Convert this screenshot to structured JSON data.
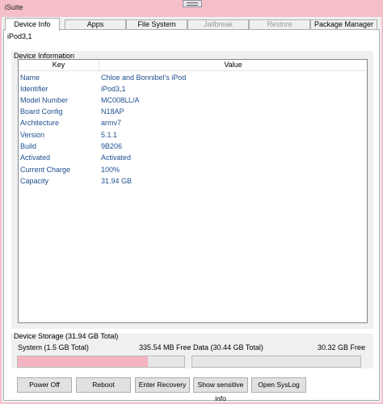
{
  "window": {
    "title": "iSuite"
  },
  "tabs": [
    {
      "label": "Device Info",
      "state": "active"
    },
    {
      "label": "Apps",
      "state": "normal"
    },
    {
      "label": "File System",
      "state": "normal"
    },
    {
      "label": "Jailbreak",
      "state": "disabled"
    },
    {
      "label": "Restore",
      "state": "disabled"
    },
    {
      "label": "Package Manager",
      "state": "normal"
    }
  ],
  "device_name": "iPod3,1",
  "device_information": {
    "legend": "Device Information",
    "columns": {
      "key": "Key",
      "value": "Value"
    },
    "rows": [
      {
        "key": "Name",
        "value": "Chloe and Bonnibel's iPod"
      },
      {
        "key": "Identifier",
        "value": "iPod3,1"
      },
      {
        "key": "Model Number",
        "value": "MC008LL/A"
      },
      {
        "key": "Board Config",
        "value": "N18AP"
      },
      {
        "key": "Architecture",
        "value": "armv7"
      },
      {
        "key": "Version",
        "value": "5.1.1"
      },
      {
        "key": "Build",
        "value": "9B206"
      },
      {
        "key": "Activated",
        "value": "Activated"
      },
      {
        "key": "Current Charge",
        "value": "100%"
      },
      {
        "key": "Capacity",
        "value": "31.94 GB"
      }
    ]
  },
  "storage": {
    "legend": "Device Storage (31.94 GB Total)",
    "system": {
      "label": "System (1.5 GB Total)",
      "free": "335.54 MB Free",
      "used_fraction": 0.78
    },
    "data": {
      "label": "Data (30.44 GB Total)",
      "free": "30.32 GB Free",
      "used_fraction": 0.0
    }
  },
  "buttons": {
    "power_off": "Power Off",
    "reboot": "Reboot",
    "enter_recovery": "Enter Recovery",
    "show_sensitive_info": "Show sensitive info",
    "open_syslog": "Open SysLog"
  },
  "colors": {
    "title_bar": "#f4bfc9",
    "progress_fill": "#f4b3c0",
    "row_text": "#1f4f8f"
  }
}
